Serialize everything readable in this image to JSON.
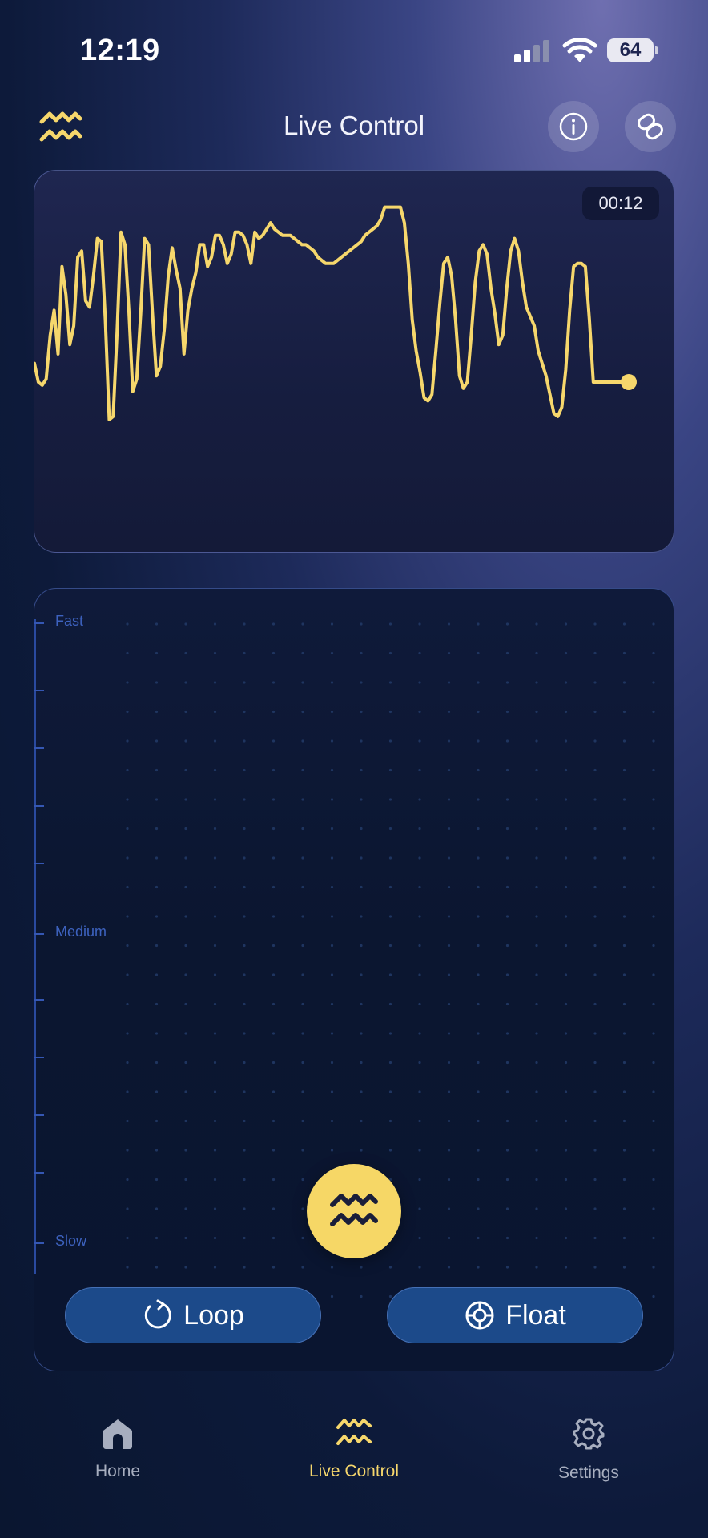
{
  "status_bar": {
    "time": "12:19",
    "battery": "64"
  },
  "header": {
    "title": "Live Control",
    "logo_icon": "wave-logo-icon",
    "info_icon": "info-icon",
    "link_icon": "link-icon"
  },
  "chart": {
    "timer": "00:12",
    "line_color": "#f6d76c",
    "chart_data": {
      "type": "line",
      "series": [
        {
          "values": [
            46,
            40,
            39,
            41,
            55,
            63,
            49,
            77,
            68,
            52,
            58,
            80,
            82,
            66,
            64,
            74,
            86,
            85,
            60,
            28,
            29,
            56,
            88,
            84,
            63,
            37,
            41,
            62,
            86,
            84,
            62,
            42,
            45,
            57,
            74,
            83,
            76,
            70,
            49,
            63,
            70,
            75,
            84,
            84,
            77,
            80,
            87,
            87,
            84,
            78,
            81,
            88,
            88,
            87,
            84,
            78,
            88,
            86,
            87,
            89,
            91,
            89,
            88,
            87,
            87,
            87,
            86,
            85,
            84,
            84,
            83,
            82,
            80,
            79,
            78,
            78,
            78,
            79,
            80,
            81,
            82,
            83,
            84,
            85,
            87,
            88,
            89,
            90,
            92,
            96,
            96,
            96,
            96,
            96,
            91,
            78,
            60,
            50,
            43,
            35,
            34,
            36,
            50,
            65,
            78,
            80,
            74,
            60,
            42,
            38,
            40,
            55,
            72,
            82,
            84,
            81,
            70,
            62,
            52,
            55,
            70,
            82,
            86,
            82,
            72,
            64,
            61,
            58,
            50,
            46,
            42,
            36,
            30,
            29,
            32,
            44,
            63,
            77,
            78,
            78,
            77,
            60,
            40,
            40,
            40,
            40,
            40,
            40,
            40,
            40,
            40,
            40
          ]
        }
      ],
      "ylim": [
        0,
        100
      ]
    }
  },
  "pad": {
    "axis_labels": {
      "fast": "Fast",
      "medium": "Medium",
      "slow": "Slow"
    },
    "knob_icon": "wave-icon",
    "loop_label": "Loop",
    "float_label": "Float"
  },
  "tabs": [
    {
      "label": "Home",
      "icon": "home-icon",
      "color": "#a7aebf"
    },
    {
      "label": "Live Control",
      "icon": "wave-icon",
      "color": "#f6d76c"
    },
    {
      "label": "Settings",
      "icon": "gear-icon",
      "color": "#a7aebf"
    }
  ]
}
